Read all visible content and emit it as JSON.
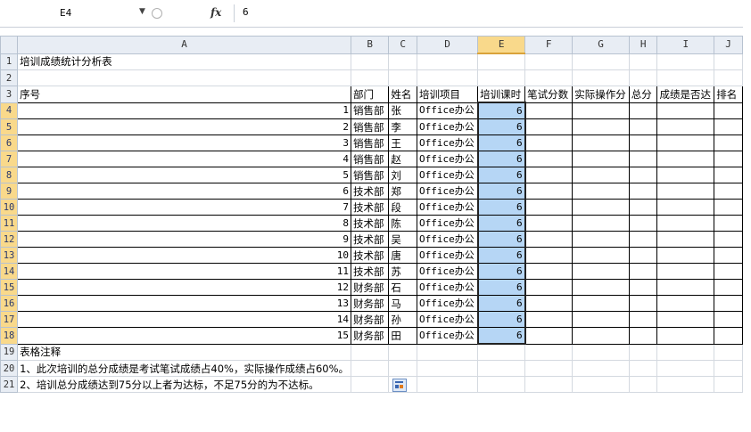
{
  "formula_bar": {
    "cell_ref": "E4",
    "fx_label": "fx",
    "value": "6"
  },
  "columns": [
    "A",
    "B",
    "C",
    "D",
    "E",
    "F",
    "G",
    "H",
    "I",
    "J"
  ],
  "sheet": {
    "title": "培训成绩统计分析表",
    "headers": [
      "序号",
      "部门",
      "姓名",
      "培训项目",
      "培训课时",
      "笔试分数",
      "实际操作分",
      "总分",
      "成绩是否达",
      "排名"
    ],
    "rows": [
      {
        "no": "1",
        "dept": "销售部",
        "name": "张",
        "project": "Office办公",
        "hours": "6"
      },
      {
        "no": "2",
        "dept": "销售部",
        "name": "李",
        "project": "Office办公",
        "hours": "6"
      },
      {
        "no": "3",
        "dept": "销售部",
        "name": "王",
        "project": "Office办公",
        "hours": "6"
      },
      {
        "no": "4",
        "dept": "销售部",
        "name": "赵",
        "project": "Office办公",
        "hours": "6"
      },
      {
        "no": "5",
        "dept": "销售部",
        "name": "刘",
        "project": "Office办公",
        "hours": "6"
      },
      {
        "no": "6",
        "dept": "技术部",
        "name": "郑",
        "project": "Office办公",
        "hours": "6"
      },
      {
        "no": "7",
        "dept": "技术部",
        "name": "段",
        "project": "Office办公",
        "hours": "6"
      },
      {
        "no": "8",
        "dept": "技术部",
        "name": "陈",
        "project": "Office办公",
        "hours": "6"
      },
      {
        "no": "9",
        "dept": "技术部",
        "name": "吴",
        "project": "Office办公",
        "hours": "6"
      },
      {
        "no": "10",
        "dept": "技术部",
        "name": "唐",
        "project": "Office办公",
        "hours": "6"
      },
      {
        "no": "11",
        "dept": "技术部",
        "name": "苏",
        "project": "Office办公",
        "hours": "6"
      },
      {
        "no": "12",
        "dept": "财务部",
        "name": "石",
        "project": "Office办公",
        "hours": "6"
      },
      {
        "no": "13",
        "dept": "财务部",
        "name": "马",
        "project": "Office办公",
        "hours": "6"
      },
      {
        "no": "14",
        "dept": "财务部",
        "name": "孙",
        "project": "Office办公",
        "hours": "6"
      },
      {
        "no": "15",
        "dept": "财务部",
        "name": "田",
        "project": "Office办公",
        "hours": "6"
      }
    ],
    "notes_label": "表格注释",
    "note1": "1、此次培训的总分成绩是考试笔试成绩占40%，实际操作成绩占60%。",
    "note2": "2、培训总分成绩达到75分以上者为达标，不足75分的为不达标。"
  },
  "colors": {
    "selection": "#b6d6f5",
    "header_selected": "#f9d98b",
    "header_bg": "#e8edf4"
  }
}
